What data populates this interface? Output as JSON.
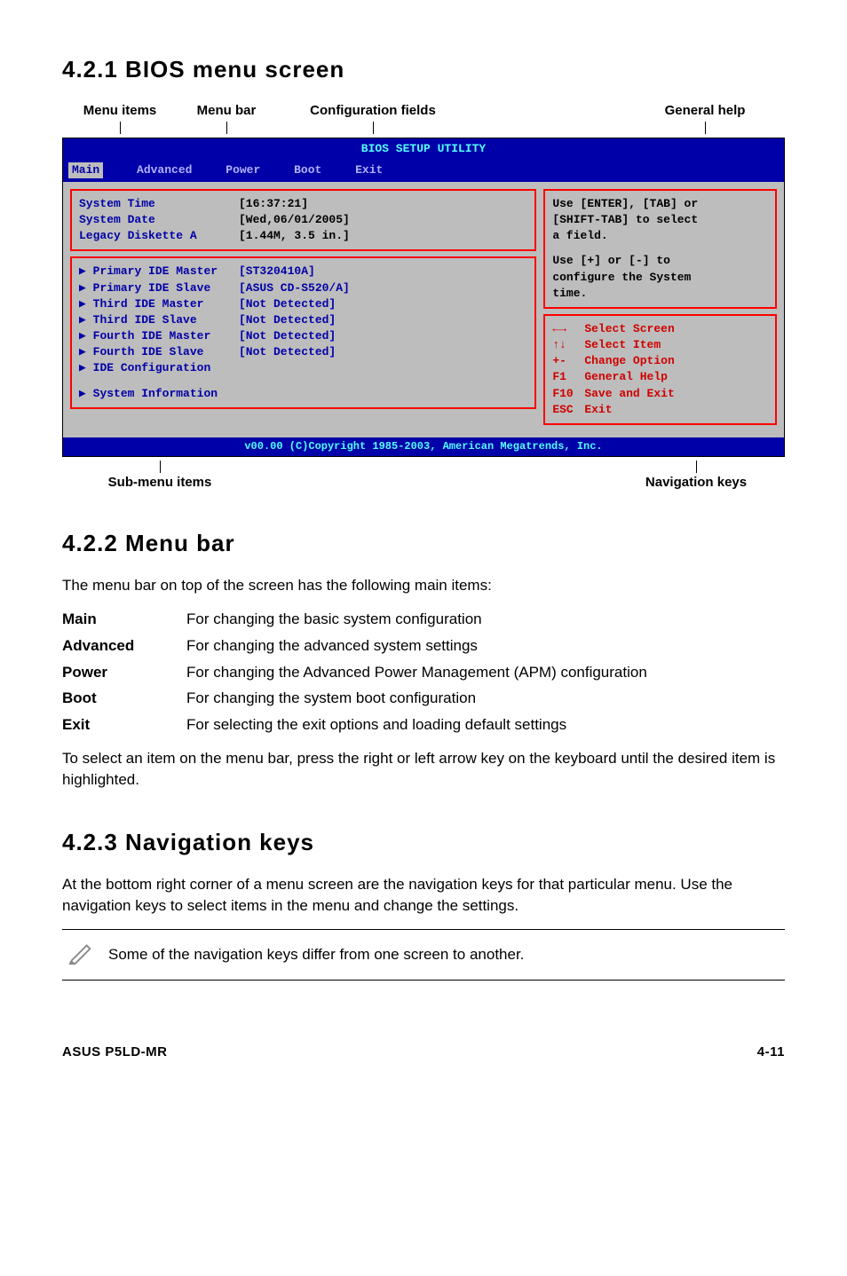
{
  "sections": {
    "bios_screen_heading": "4.2.1   BIOS menu screen",
    "menu_bar_heading": "4.2.2   Menu bar",
    "nav_keys_heading": "4.2.3   Navigation keys"
  },
  "top_labels": {
    "menu_items": "Menu items",
    "menu_bar": "Menu bar",
    "config_fields": "Configuration fields",
    "general_help": "General help"
  },
  "bios": {
    "title": "BIOS SETUP UTILITY",
    "tabs": {
      "main": "Main",
      "advanced": "Advanced",
      "power": "Power",
      "boot": "Boot",
      "exit": "Exit"
    },
    "left_top": {
      "system_time_k": "System Time",
      "system_time_v": "[16:37:21]",
      "system_date_k": "System Date",
      "system_date_v": "[Wed,06/01/2005]",
      "legacy_k": "Legacy Diskette A",
      "legacy_v": "[1.44M, 3.5 in.]"
    },
    "left_mid": {
      "pim_k": "Primary IDE Master",
      "pim_v": "[ST320410A]",
      "pis_k": "Primary IDE Slave",
      "pis_v": "[ASUS CD-S520/A]",
      "tim_k": "Third IDE Master",
      "tim_v": "[Not Detected]",
      "tis_k": "Third IDE Slave",
      "tis_v": "[Not Detected]",
      "fom_k": "Fourth IDE Master",
      "fom_v": "[Not Detected]",
      "fos_k": "Fourth IDE Slave",
      "fos_v": "[Not Detected]",
      "idec": "IDE Configuration",
      "sysinfo": "System Information"
    },
    "right_top": {
      "line1": "Use [ENTER], [TAB] or",
      "line2": "[SHIFT-TAB] to select",
      "line3": "a field.",
      "line4": "Use [+] or [-] to",
      "line5": "configure the System",
      "line6": "time."
    },
    "right_nav": {
      "select_screen_k": "←→",
      "select_screen": "Select Screen",
      "select_item_k": "↑↓",
      "select_item": "Select Item",
      "change_opt_k": "+-",
      "change_opt": "Change Option",
      "gen_help_k": "F1",
      "gen_help": "General Help",
      "save_exit_k": "F10",
      "save_exit": "Save and Exit",
      "exit_k": "ESC",
      "exit": "Exit"
    },
    "footer": "v00.00 (C)Copyright 1985-2003, American Megatrends, Inc."
  },
  "bottom_labels": {
    "sub_menu": "Sub-menu items",
    "nav_keys": "Navigation keys"
  },
  "menu_bar_intro": "The menu bar on top of the screen has the following main items:",
  "defs": {
    "main_k": "Main",
    "main_v": "For changing the basic system configuration",
    "adv_k": "Advanced",
    "adv_v": "For changing the advanced system settings",
    "pow_k": "Power",
    "pow_v": "For changing the Advanced Power Management (APM) configuration",
    "boot_k": "Boot",
    "boot_v": "For changing the system boot configuration",
    "exit_k": "Exit",
    "exit_v": "For selecting the exit options and loading default settings"
  },
  "menu_bar_outro": "To select an item on the menu bar, press the right or left arrow key on the keyboard until the desired item is highlighted.",
  "nav_keys_text": "At the bottom right corner of a menu screen are the navigation keys for that particular menu. Use the navigation keys to select items in the menu and change the settings.",
  "note_text": "Some of the navigation keys differ from one screen to another.",
  "footer": {
    "left": "ASUS P5LD-MR",
    "right": "4-11"
  }
}
